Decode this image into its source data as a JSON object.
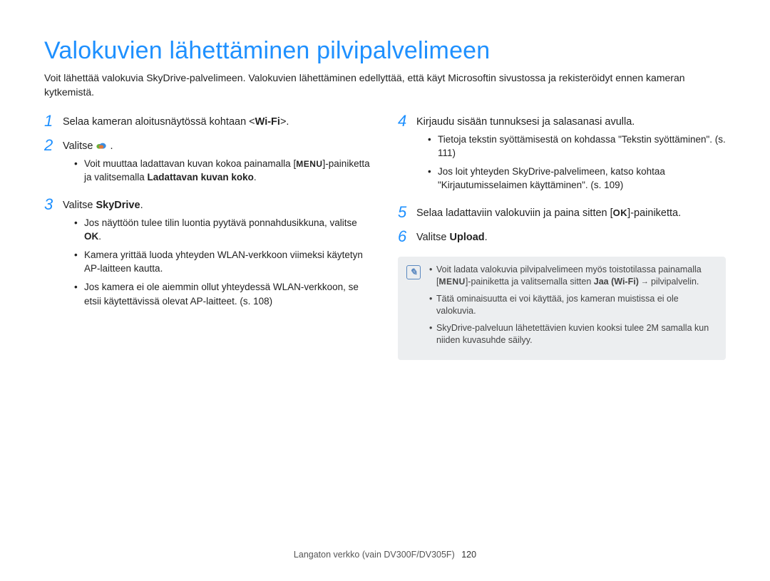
{
  "title": "Valokuvien lähettäminen pilvipalvelimeen",
  "intro": "Voit lähettää valokuvia SkyDrive-palvelimeen. Valokuvien lähettäminen edellyttää, että käyt Microsoftin sivustossa ja rekisteröidyt ennen kameran kytkemistä.",
  "left": {
    "step1": {
      "num": "1",
      "text_a": "Selaa kameran aloitusnäytössä kohtaan ",
      "angle_open": "<",
      "wifi_bold": "Wi-Fi",
      "angle_close": ">.",
      "text_end": ""
    },
    "step2": {
      "num": "2",
      "text_a": "Valitse ",
      "text_end": ".",
      "sub": [
        {
          "pre": "Voit muuttaa ladattavan kuvan kokoa painamalla [",
          "menu": "MENU",
          "mid": "]-painiketta ja valitsemalla ",
          "bold": "Ladattavan kuvan koko",
          "post": "."
        }
      ]
    },
    "step3": {
      "num": "3",
      "text_a": "Valitse ",
      "bold": "SkyDrive",
      "text_end": ".",
      "sub": [
        {
          "text_a": "Jos näyttöön tulee tilin luontia pyytävä ponnahdusikkuna, valitse ",
          "bold": "OK",
          "post": "."
        },
        {
          "text": "Kamera yrittää luoda yhteyden WLAN-verkkoon viimeksi käytetyn AP-laitteen kautta."
        },
        {
          "text": "Jos kamera ei ole aiemmin ollut yhteydessä WLAN-verkkoon, se etsii käytettävissä olevat AP-laitteet. (s. 108)"
        }
      ]
    }
  },
  "right": {
    "step4": {
      "num": "4",
      "text": "Kirjaudu sisään tunnuksesi ja salasanasi avulla.",
      "sub": [
        {
          "text": "Tietoja tekstin syöttämisestä on kohdassa \"Tekstin syöttäminen\". (s. 111)"
        },
        {
          "text": "Jos loit yhteyden SkyDrive-palvelimeen, katso kohtaa \"Kirjautumisselaimen käyttäminen\". (s. 109)"
        }
      ]
    },
    "step5": {
      "num": "5",
      "text_a": "Selaa ladattaviin valokuviin ja paina sitten [",
      "ok": "OK",
      "text_b": "]-painiketta."
    },
    "step6": {
      "num": "6",
      "text_a": "Valitse ",
      "bold": "Upload",
      "text_end": "."
    },
    "note": {
      "items": [
        {
          "pre": "Voit ladata valokuvia pilvipalvelimeen myös toistotilassa painamalla [",
          "menu": "MENU",
          "mid": "]-painiketta ja valitsemalla sitten ",
          "bold": "Jaa (Wi-Fi)",
          "arrow": " → ",
          "post": "pilvipalvelin."
        },
        {
          "text": "Tätä ominaisuutta ei voi käyttää, jos kameran muistissa ei ole valokuvia."
        },
        {
          "text": "SkyDrive-palveluun lähetettävien kuvien kooksi tulee 2M samalla kun niiden kuvasuhde säilyy."
        }
      ]
    }
  },
  "footer": {
    "section": "Langaton verkko (vain DV300F/DV305F)",
    "page": "120"
  }
}
